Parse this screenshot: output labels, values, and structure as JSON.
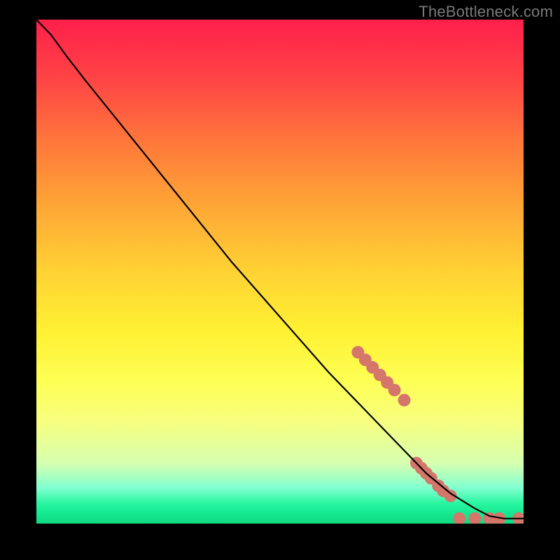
{
  "watermark": "TheBottleneck.com",
  "chart_data": {
    "type": "line",
    "title": "",
    "xlabel": "",
    "ylabel": "",
    "xlim": [
      0,
      100
    ],
    "ylim": [
      0,
      100
    ],
    "grid": false,
    "legend": false,
    "series": [
      {
        "name": "curve",
        "color": "#000000",
        "x": [
          0,
          3,
          6,
          10,
          15,
          20,
          30,
          40,
          50,
          60,
          70,
          80,
          85,
          90,
          93,
          96,
          100
        ],
        "y": [
          100,
          97,
          93,
          88,
          82,
          76,
          64,
          52,
          41,
          30,
          20,
          10,
          6,
          3,
          1.5,
          1,
          1
        ]
      }
    ],
    "markers": {
      "name": "dots",
      "color": "#d5766b",
      "radius_px": 9,
      "points": [
        {
          "x": 66,
          "y": 34
        },
        {
          "x": 67.5,
          "y": 32.5
        },
        {
          "x": 69,
          "y": 31
        },
        {
          "x": 70.5,
          "y": 29.5
        },
        {
          "x": 72,
          "y": 28
        },
        {
          "x": 73.5,
          "y": 26.5
        },
        {
          "x": 75.5,
          "y": 24.5
        },
        {
          "x": 78,
          "y": 12
        },
        {
          "x": 79,
          "y": 11
        },
        {
          "x": 80,
          "y": 10
        },
        {
          "x": 81,
          "y": 9
        },
        {
          "x": 82.5,
          "y": 7.5
        },
        {
          "x": 83.5,
          "y": 6.5
        },
        {
          "x": 85,
          "y": 5.5
        },
        {
          "x": 86.8,
          "y": 1
        },
        {
          "x": 90,
          "y": 1
        },
        {
          "x": 93,
          "y": 1
        },
        {
          "x": 95,
          "y": 1
        },
        {
          "x": 99,
          "y": 1
        }
      ]
    }
  }
}
